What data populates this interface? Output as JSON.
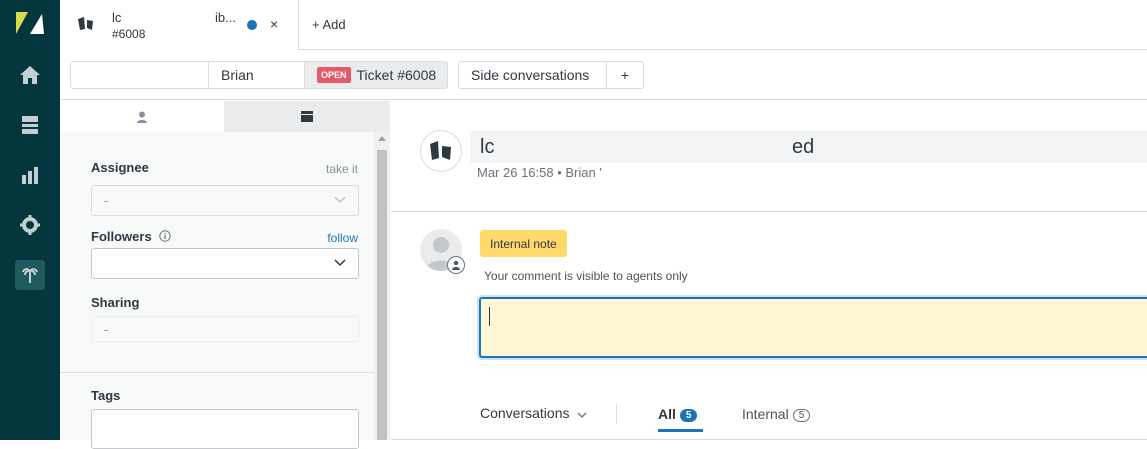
{
  "colors": {
    "nav_bg": "#03363d",
    "accent_blue": "#1f73b7",
    "open_badge": "#e35b66",
    "internal_note": "#ffd96a",
    "comment_bg": "#fff6d6"
  },
  "nav": {
    "items": [
      "home-icon",
      "views-icon",
      "reporting-icon",
      "admin-icon",
      "apps-icon"
    ]
  },
  "tabs": [
    {
      "title_left": "lс",
      "title_right": "ib...",
      "subtitle": "#6008"
    }
  ],
  "topbar": {
    "add_label": "Add",
    "add_icon": "+",
    "close_glyph": "×"
  },
  "breadcrumb": {
    "requester": "Brian",
    "status_badge": "OPEN",
    "ticket": "Ticket #6008",
    "side_conversations": "Side conversations",
    "plus": "+"
  },
  "sidebar": {
    "assignee": {
      "label": "Assignee",
      "link": "take it",
      "value": "-"
    },
    "followers": {
      "label": "Followers",
      "link": "follow",
      "value": ""
    },
    "sharing": {
      "label": "Sharing",
      "value": "-"
    },
    "tags": {
      "label": "Tags"
    }
  },
  "ticket": {
    "subject_left": "lc",
    "subject_right": "ed",
    "meta": "Mar 26 16:58 • Brian '"
  },
  "composer": {
    "mode": "Internal note",
    "visibility": "Your comment is visible to agents only",
    "value": ""
  },
  "conversation_tabs": {
    "dropdown": "Conversations",
    "all_label": "All",
    "all_count": "5",
    "internal_label": "Internal",
    "internal_count": "5"
  }
}
